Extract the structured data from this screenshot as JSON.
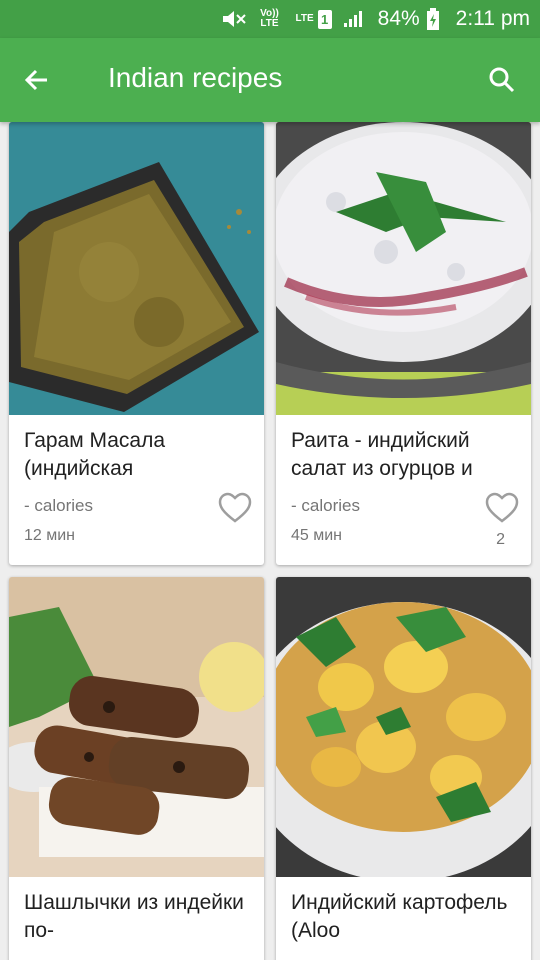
{
  "status": {
    "battery": "84%",
    "time": "2:11 pm",
    "volte": "Vo)) LTE",
    "lte": "LTE",
    "sim": "1"
  },
  "appbar": {
    "title": "Indian recipes"
  },
  "recipes": [
    {
      "name": "Гарам Масала (индийская",
      "calories": "- calories",
      "time": "12 мин",
      "likes": ""
    },
    {
      "name": "Раита - индийский салат из огурцов и",
      "calories": "- calories",
      "time": "45 мин",
      "likes": "2"
    },
    {
      "name": "Шашлычки из индейки по-",
      "calories": "",
      "time": "",
      "likes": ""
    },
    {
      "name": "Индийский картофель (Aloo",
      "calories": "",
      "time": "",
      "likes": ""
    }
  ],
  "colors": {
    "status_bar": "#43a047",
    "app_bar": "#4caf50",
    "heart": "#9e9e9e"
  }
}
